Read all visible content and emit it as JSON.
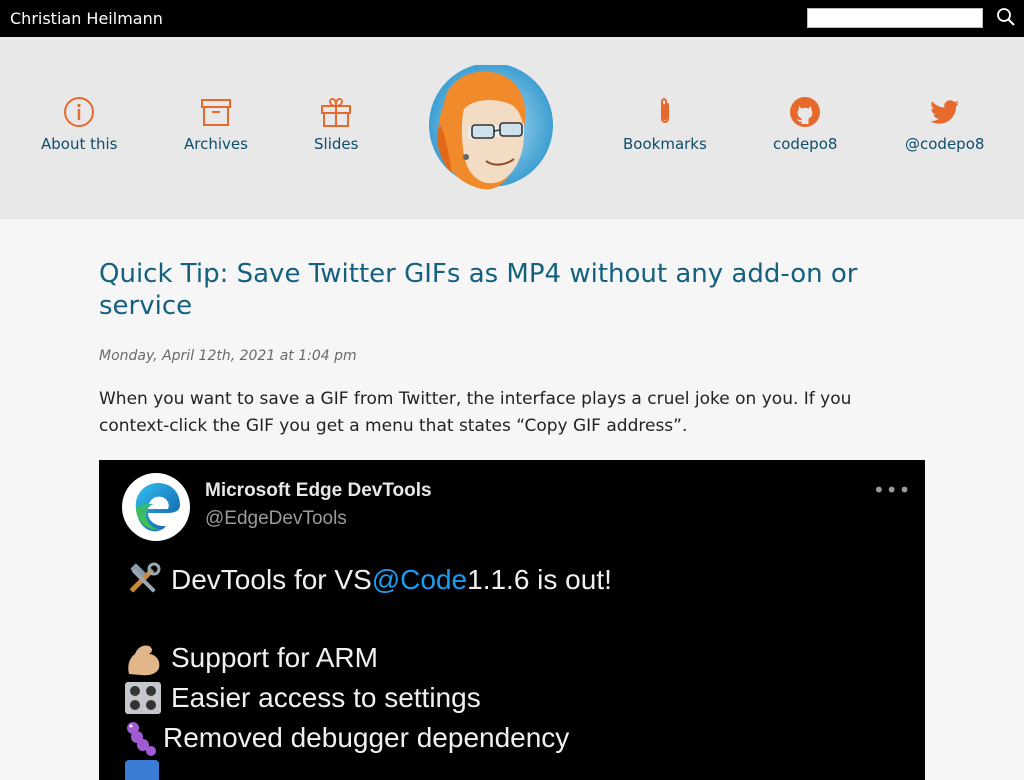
{
  "site": {
    "title": "Christian Heilmann",
    "search_placeholder": ""
  },
  "nav": {
    "left": [
      {
        "label": "About this",
        "icon": "info-icon"
      },
      {
        "label": "Archives",
        "icon": "archive-box-icon"
      },
      {
        "label": "Slides",
        "icon": "gift-icon"
      }
    ],
    "right": [
      {
        "label": "Bookmarks",
        "icon": "paperclip-icon"
      },
      {
        "label": "codepo8",
        "icon": "github-icon"
      },
      {
        "label": "@codepo8",
        "icon": "twitter-icon"
      }
    ]
  },
  "post": {
    "title": "Quick Tip: Save Twitter GIFs as MP4 without any add-on or service",
    "date": "Monday, April 12th, 2021 at 1:04 pm",
    "intro": "When you want to save a GIF from Twitter, the interface plays a cruel joke on you. If you context-click the GIF you get a menu that states “Copy GIF address”."
  },
  "tweet": {
    "name": "Microsoft Edge DevTools",
    "handle": "@EdgeDevTools",
    "more": "•••",
    "line1_prefix": "DevTools for VS ",
    "line1_mention": "@Code",
    "line1_suffix": " 1.1.6 is out!",
    "line2": "Support for ARM",
    "line3": "Easier access to settings",
    "line4": "Removed debugger dependency"
  },
  "colors": {
    "accent_orange": "#e8692c",
    "link_blue": "#0e4d6b",
    "title_blue": "#14607e",
    "mention_blue": "#1d9bf0"
  }
}
